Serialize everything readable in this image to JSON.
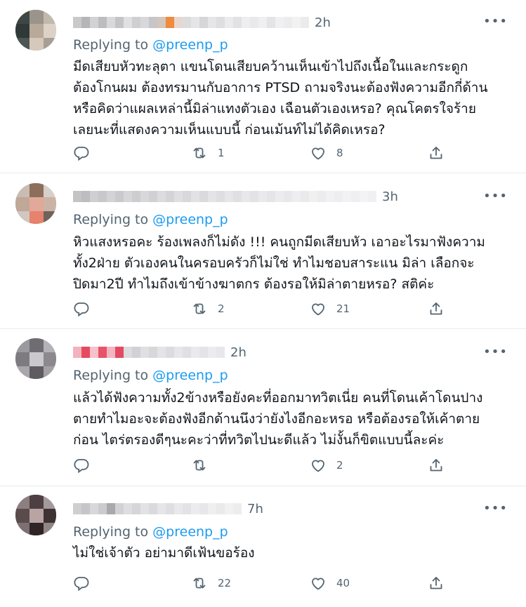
{
  "tweets": [
    {
      "time": "2h",
      "reply_prefix": "Replying to",
      "reply_handle": "@preenp_p",
      "lines": [
        "มีดเสียบหัวทะลุตา แขนโดนเสียบคว้านเห็นเข้าไปถึงเนื้อในและกระดูก",
        "ต้องโกนผม ต้องทรมานกับอาการ PTSD ถามจริงนะต้องฟังความอีกกี่ด้าน",
        "หรือคิดว่าแผลเหล่านี้มิล่าแทงตัวเอง เฉือนตัวเองเหรอ? คุณโคตรใจร้าย",
        "เลยนะที่แสดงความเห็นแบบนี้ ก่อนเม้นท์ไม่ได้คิดเหรอ?"
      ],
      "replies": "",
      "retweets": "1",
      "likes": "8"
    },
    {
      "time": "3h",
      "reply_prefix": "Replying to",
      "reply_handle": "@preenp_p",
      "lines": [
        "หิวแสงหรอคะ ร้องเพลงก็ไม่ดัง !!! คนถูกมีดเสียบหัว เอาอะไรมาฟังความ",
        "ทั้ง2ฝ่าย ตัวเองคนในครอบครัวก็ไม่ใช่ ทำไมชอบสาระแน มิล่า เลือกจะ",
        "ปิดมา2ปี ทำไมถึงเข้าข้างฆาตกร ต้องรอให้มิล่าตายหรอ? สติค่ะ"
      ],
      "replies": "",
      "retweets": "2",
      "likes": "21"
    },
    {
      "time": "2h",
      "reply_prefix": "Replying to",
      "reply_handle": "@preenp_p",
      "lines": [
        "แล้วได้ฟังความทั้ง2ข้างหรือยังคะที่ออกมาทวิตเนี่ย คนที่โดนเค้าโดนปาง",
        "ตายทำไมอะจะต้องฟังอีกด้านนึงว่ายังไงอีกอะหรอ หรือต้องรอให้เค้าตาย",
        "ก่อน ไตร่ตรองดีๆนะคะว่าที่ทวิตไปนะดีแล้ว ไม่งั้นก็ขิตแบบนี้ละค่ะ"
      ],
      "replies": "",
      "retweets": "",
      "likes": "2"
    },
    {
      "time": "7h",
      "reply_prefix": "Replying to",
      "reply_handle": "@preenp_p",
      "lines": [
        "ไม่ใช่เจ้าตัว อย่ามาดีเฟ้นขอร้อง"
      ],
      "replies": "",
      "retweets": "22",
      "likes": "40"
    }
  ],
  "icons": {
    "reply": "reply-icon",
    "retweet": "retweet-icon",
    "like": "heart-icon",
    "share": "share-icon",
    "more": "more-icon"
  },
  "colors": {
    "text": "#0f1419",
    "secondary": "#536471",
    "link": "#1d9bf0",
    "divider": "#e7ecf0"
  }
}
